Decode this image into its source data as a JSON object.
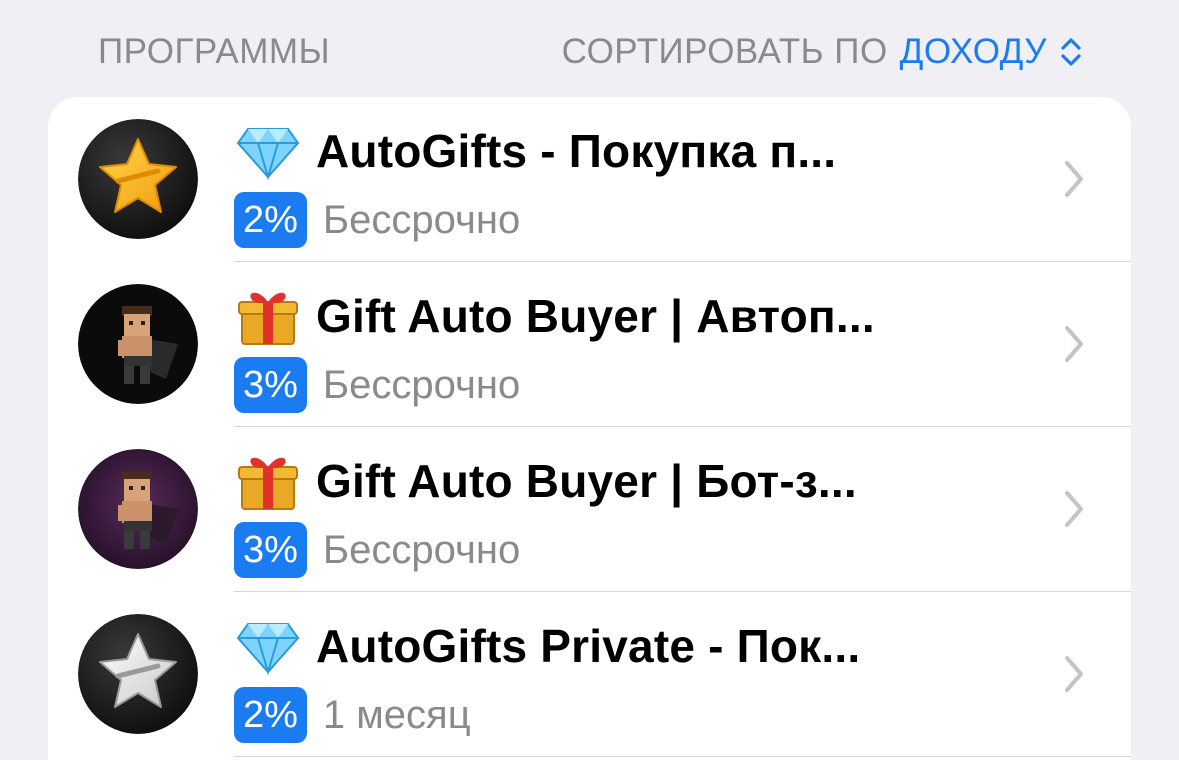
{
  "header": {
    "section_title": "ПРОГРАММЫ",
    "sort_prefix": "СОРТИРОВАТЬ ПО",
    "sort_value": "ДОХОДУ",
    "sort_icon": "chevron-up-down-icon"
  },
  "colors": {
    "accent": "#1b7cf2",
    "secondary_text": "#8a8a8e",
    "background": "#efeff4",
    "card": "#ffffff"
  },
  "programs": [
    {
      "avatar": "star-yellow-avatar",
      "emoji": "gem-icon",
      "title": "AutoGifts - Покупка п...",
      "percent": "2%",
      "duration": "Бессрочно"
    },
    {
      "avatar": "pixel-character-avatar",
      "emoji": "gift-icon",
      "title": "Gift Auto Buyer | Автоп...",
      "percent": "3%",
      "duration": "Бессрочно"
    },
    {
      "avatar": "pixel-character-purple-avatar",
      "emoji": "gift-icon",
      "title": "Gift Auto Buyer | Бот-з...",
      "percent": "3%",
      "duration": "Бессрочно"
    },
    {
      "avatar": "star-white-avatar",
      "emoji": "gem-icon",
      "title": "AutoGifts Private - Пок...",
      "percent": "2%",
      "duration": "1 месяц"
    }
  ]
}
